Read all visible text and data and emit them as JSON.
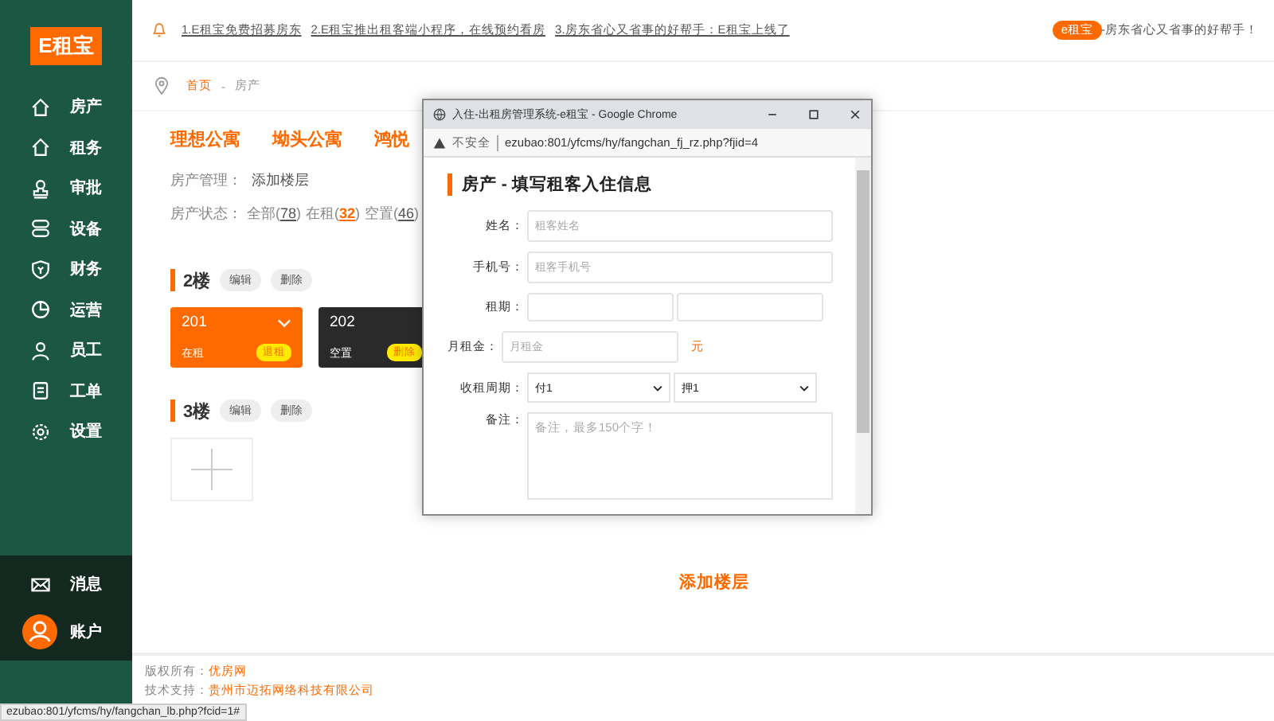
{
  "sidebar": {
    "logo": "E租宝",
    "items": [
      "房产",
      "租务",
      "审批",
      "设备",
      "财务",
      "运营",
      "员工",
      "工单",
      "设置"
    ],
    "bottom_items": [
      "消息",
      "账户"
    ]
  },
  "notice": {
    "items": [
      "1.E租宝免费招募房东",
      "2.E租宝推出租客端小程序，在线预约看房",
      "3.房东省心又省事的好帮手：E租宝上线了"
    ],
    "badge": "e租宝",
    "slogan": "-房东省心又省事的好帮手！"
  },
  "breadcrumb": {
    "home": "首页",
    "separator": "-",
    "current": "房产"
  },
  "property_tabs": [
    "理想公寓",
    "坳头公寓",
    "鸿悦"
  ],
  "management": {
    "label": "房产管理：",
    "link": "添加楼层"
  },
  "status": {
    "label": "房产状态：",
    "filters": [
      {
        "label": "全部(",
        "count": "78",
        "close": ")",
        "highlight": false
      },
      {
        "label": "在租(",
        "count": "32",
        "close": ")",
        "highlight": true
      },
      {
        "label": "空置(",
        "count": "46",
        "close": ")",
        "highlight": false
      }
    ]
  },
  "floors": [
    {
      "name": "2楼",
      "actions": [
        "编辑",
        "删除"
      ],
      "rooms": [
        {
          "number": "201",
          "status": "在租",
          "kind": "rented",
          "action": "退租"
        },
        {
          "number": "202",
          "status": "空置",
          "kind": "vacant",
          "action": "删除"
        }
      ]
    },
    {
      "name": "3楼",
      "actions": [
        "编辑",
        "删除"
      ]
    }
  ],
  "add_floor_button": "添加楼层",
  "footer": {
    "copyright_label": "版权所有：",
    "copyright_value": "优房网",
    "support_label": "技术支持：",
    "support_value": "贵州市迈拓网络科技有限公司"
  },
  "status_bar_url": "ezubao:801/yfcms/hy/fangchan_lb.php?fcid=1#",
  "popup": {
    "title": "入住-出租房管理系统-e租宝 - Google Chrome",
    "security": "不安全",
    "url": "ezubao:801/yfcms/hy/fangchan_fj_rz.php?fjid=4",
    "heading": "房产 - 填写租客入住信息",
    "fields": [
      {
        "label": "姓名：",
        "kind": "text",
        "placeholder": "租客姓名"
      },
      {
        "label": "手机号：",
        "kind": "text",
        "placeholder": "租客手机号"
      },
      {
        "label": "租期：",
        "kind": "range"
      },
      {
        "label": "月租金：",
        "kind": "money",
        "placeholder": "月租金",
        "unit": "元"
      },
      {
        "label": "收租周期：",
        "kind": "selects",
        "values": [
          "付1",
          "押1"
        ]
      },
      {
        "label": "备注：",
        "kind": "textarea",
        "placeholder": "备注，最多150个字！"
      }
    ]
  }
}
